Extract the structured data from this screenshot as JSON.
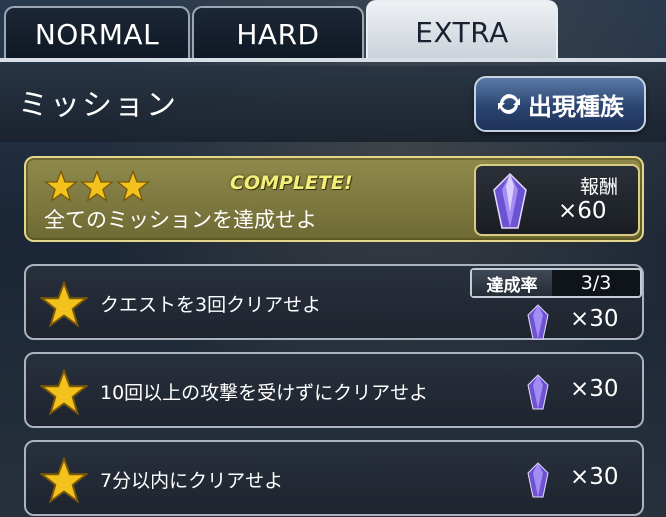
{
  "tabs": [
    {
      "label": "NORMAL"
    },
    {
      "label": "HARD"
    },
    {
      "label": "EXTRA"
    }
  ],
  "header": {
    "title": "ミッション",
    "appear_button": "出現種族"
  },
  "complete_panel": {
    "stars": 3,
    "status": "COMPLETE!",
    "text": "全てのミッションを達成せよ",
    "reward_label": "報酬",
    "reward_amount": "×60"
  },
  "achievement": {
    "label": "達成率",
    "value": "3/3"
  },
  "missions": [
    {
      "text": "クエストを3回クリアせよ",
      "reward": "×30"
    },
    {
      "text": "10回以上の攻撃を受けずにクリアせよ",
      "reward": "×30"
    },
    {
      "text": "7分以内にクリアせよ",
      "reward": "×30"
    }
  ],
  "colors": {
    "star": "#f3c21d",
    "gem": "#8a6be0",
    "complete_label": "#f3ef7a",
    "appear_button": "#2b4572"
  }
}
